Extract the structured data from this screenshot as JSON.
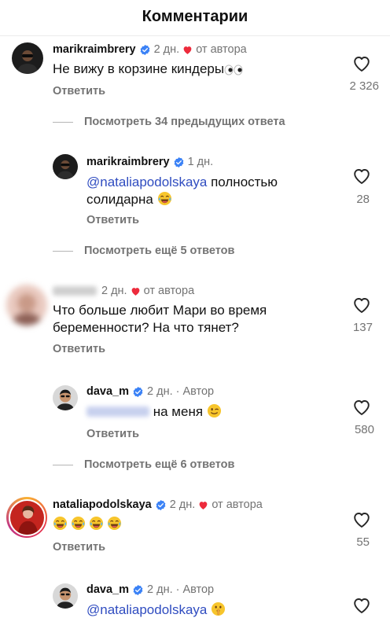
{
  "header": {
    "title": "Комментарии"
  },
  "icons": {
    "verified": "verified-badge-icon",
    "author_like": "heart-red-icon",
    "like": "heart-outline-icon",
    "laugh": "tears-of-joy-emoji",
    "eyes": "eyes-emoji",
    "wink": "wink-emoji",
    "shush": "shushing-face-emoji"
  },
  "colors": {
    "mention": "#2f4cc0",
    "heart": "#ed2b3c",
    "verified": "#3b82f6",
    "muted": "#737373"
  },
  "comments": [
    {
      "username": "marikraimbrery",
      "time": "2 дн.",
      "author_label": "от автора",
      "text": "Не вижу в корзине киндеры",
      "reply_label": "Ответить",
      "likes": "2 326",
      "view_replies": "Посмотреть 34 предыдущих ответа"
    },
    {
      "username": "marikraimbrery",
      "time": "1 дн.",
      "mention": "@nataliapodolskaya",
      "text": "полностью",
      "text_line2": "солидарна",
      "reply_label": "Ответить",
      "likes": "28",
      "view_replies": "Посмотреть ещё 5 ответов"
    },
    {
      "username": "",
      "time": "2 дн.",
      "author_label": "от автора",
      "text": "Что больше любит Мари во время",
      "text_line2": "беременности? На что тянет?",
      "reply_label": "Ответить",
      "likes": "137"
    },
    {
      "username": "dava_m",
      "time": "2 дн.",
      "author_label": "Автор",
      "separator": "·",
      "text": "на меня",
      "reply_label": "Ответить",
      "likes": "580",
      "view_replies": "Посмотреть ещё 6 ответов"
    },
    {
      "username": "nataliapodolskaya",
      "time": "2 дн.",
      "author_label": "от автора",
      "reply_label": "Ответить",
      "likes": "55"
    },
    {
      "username": "dava_m",
      "time": "2 дн.",
      "author_label": "Автор",
      "separator": "·",
      "mention": "@nataliapodolskaya"
    }
  ]
}
